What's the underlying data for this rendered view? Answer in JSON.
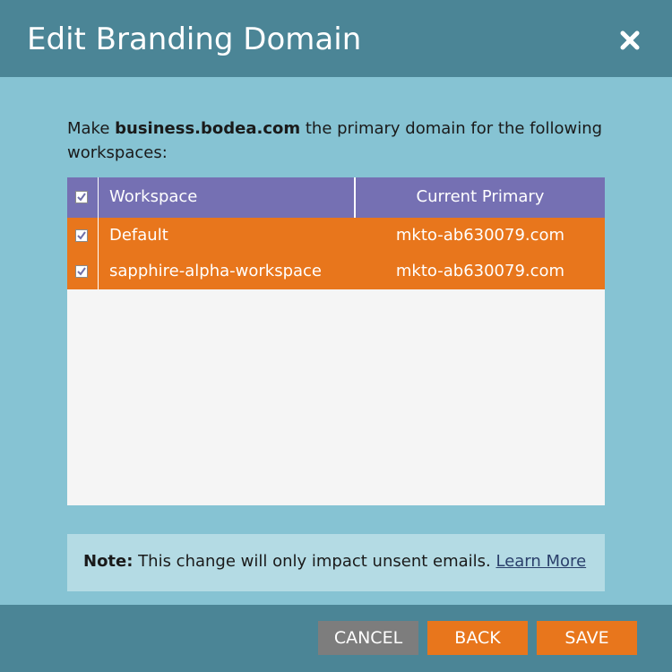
{
  "dialog": {
    "title": "Edit Branding Domain",
    "close_icon": "close-icon"
  },
  "intro": {
    "prefix": "Make ",
    "domain": "business.bodea.com",
    "suffix": " the primary domain for the following workspaces:"
  },
  "grid": {
    "header_checked": true,
    "columns": [
      "Workspace",
      "Current Primary"
    ],
    "rows": [
      {
        "checked": true,
        "workspace": "Default",
        "current_primary": "mkto-ab630079.com"
      },
      {
        "checked": true,
        "workspace": "sapphire-alpha-workspace",
        "current_primary": "mkto-ab630079.com"
      }
    ]
  },
  "note": {
    "label": "Note:",
    "text": " This change will only impact unsent emails. ",
    "link": "Learn More"
  },
  "footer": {
    "cancel": "CANCEL",
    "back": "BACK",
    "save": "SAVE"
  },
  "colors": {
    "header_bg": "#4b8596",
    "body_bg": "#86c3d3",
    "grid_header": "#7570b3",
    "row_selected": "#e8761c",
    "note_bg": "#b4dbe4",
    "cancel_bg": "#7d7d7d"
  }
}
